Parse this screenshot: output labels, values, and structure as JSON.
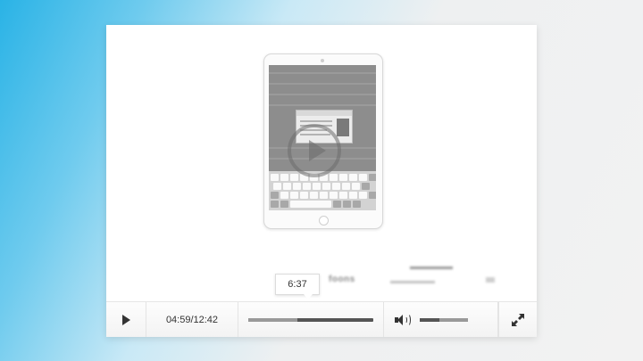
{
  "player": {
    "current_time": "04:59",
    "duration": "12:42",
    "time_display": "04:59/12:42",
    "hover_tooltip": "6:37",
    "progress_fraction": 0.39,
    "buffered_fraction": 0.0,
    "volume_fraction": 0.41
  },
  "icons": {
    "play_overlay": "play-circle-icon",
    "play": "play-icon",
    "volume": "volume-icon",
    "fullscreen": "fullscreen-icon"
  },
  "colors": {
    "track_played": "#555555",
    "track_unplayed": "#999999",
    "background_gradient_start": "#2ab3e6"
  }
}
